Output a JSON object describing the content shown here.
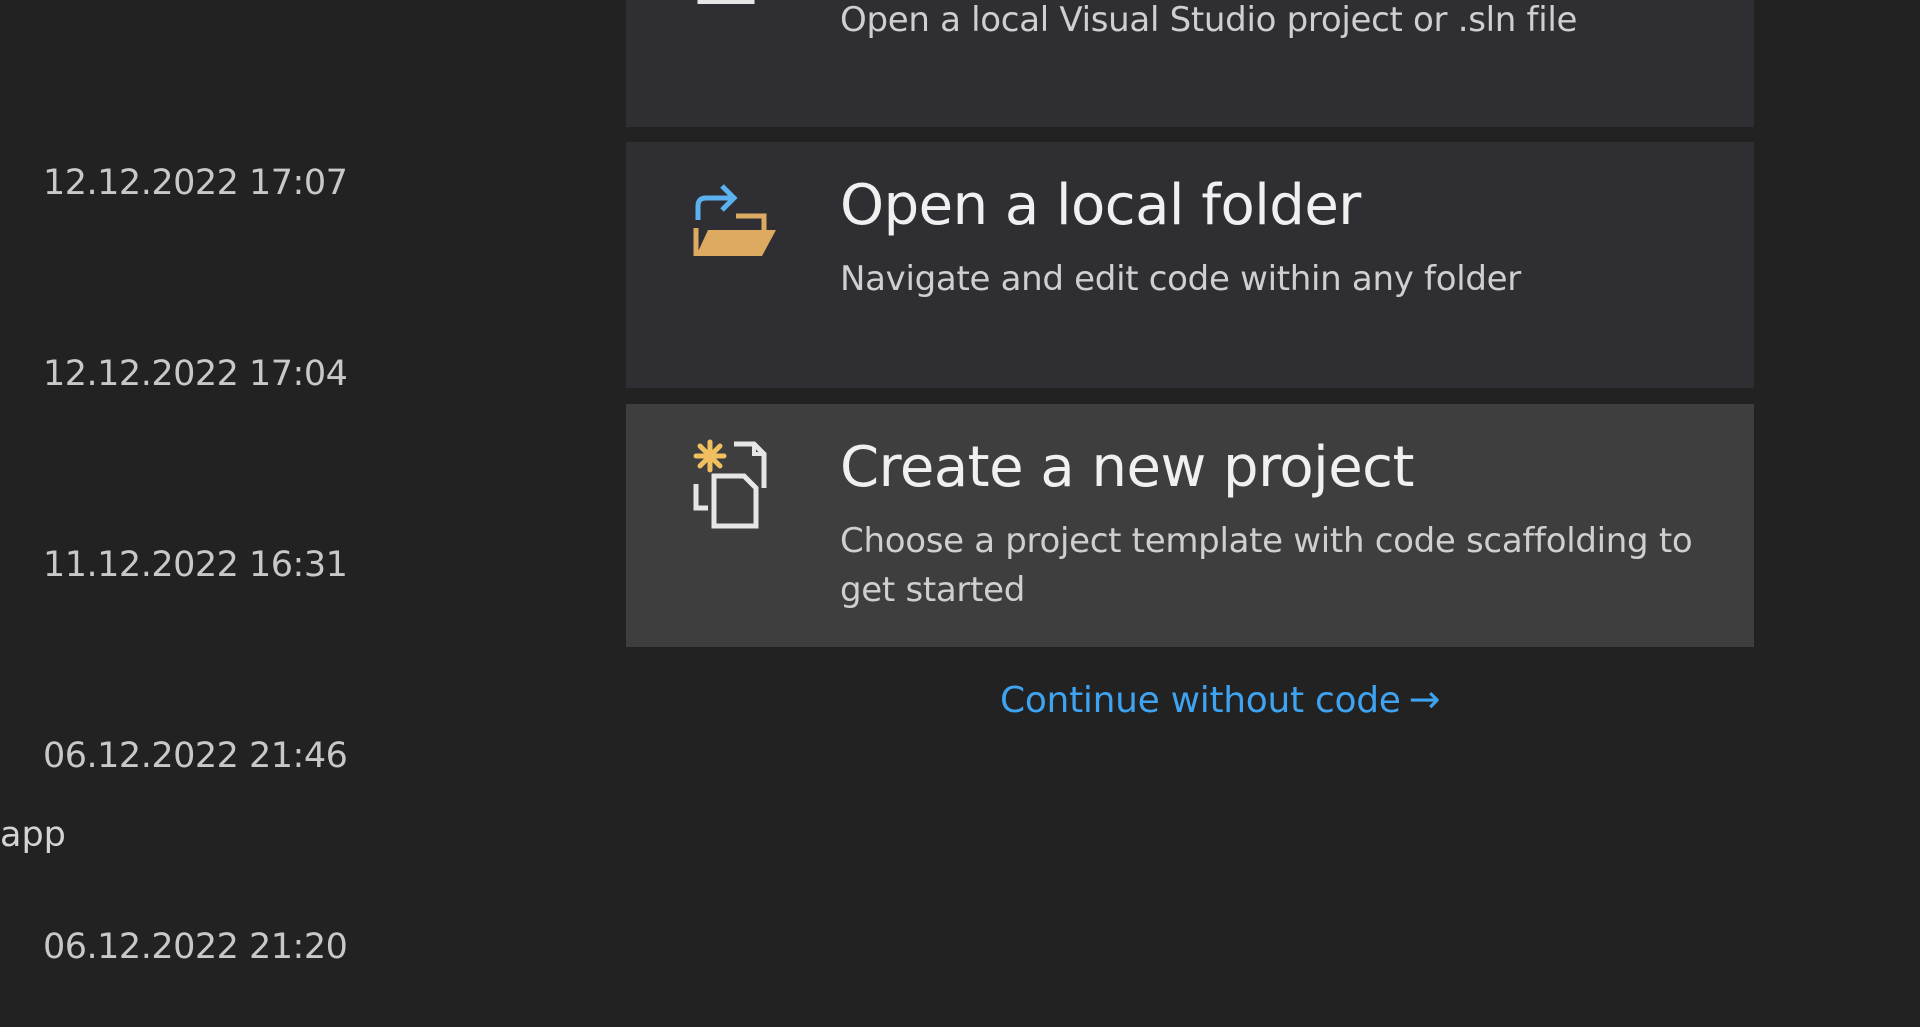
{
  "recent": {
    "items": [
      {
        "date": "12.12.2022 17:07"
      },
      {
        "date": "12.12.2022 17:04"
      },
      {
        "date": "11.12.2022 16:31"
      },
      {
        "date": "06.12.2022 21:46",
        "name_fragment": "app"
      },
      {
        "date": "06.12.2022 21:20"
      }
    ]
  },
  "get_started": {
    "open_project": {
      "description": "Open a local Visual Studio project or .sln file",
      "icon": "open-project-icon"
    },
    "open_folder": {
      "title": "Open a local folder",
      "description": "Navigate and edit code within any folder",
      "icon": "open-folder-icon"
    },
    "new_project": {
      "title": "Create a new project",
      "description": "Choose a project template with code scaffolding to get started",
      "icon": "new-project-icon"
    },
    "continue_link": "Continue without code",
    "continue_arrow": "→"
  },
  "colors": {
    "background": "#222222",
    "card": "#2f2f33",
    "card_hover": "#3e3e3e",
    "link": "#3ea3f0",
    "folder_accent": "#dcaa60",
    "arrow_accent": "#5cb2f0"
  }
}
